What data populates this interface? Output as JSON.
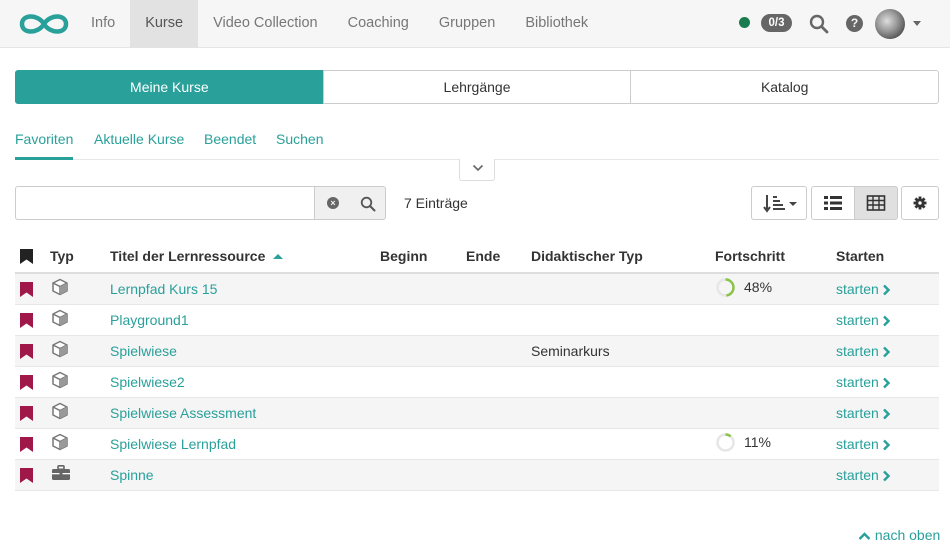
{
  "nav": {
    "items": [
      {
        "label": "Info",
        "active": false
      },
      {
        "label": "Kurse",
        "active": true
      },
      {
        "label": "Video Collection",
        "active": false
      },
      {
        "label": "Coaching",
        "active": false
      },
      {
        "label": "Gruppen",
        "active": false
      },
      {
        "label": "Bibliothek",
        "active": false
      }
    ],
    "badge": "0/3",
    "status_color": "#1a7c4e"
  },
  "segments": [
    {
      "label": "Meine Kurse",
      "active": true
    },
    {
      "label": "Lehrgänge",
      "active": false
    },
    {
      "label": "Katalog",
      "active": false
    }
  ],
  "subtabs": [
    {
      "label": "Favoriten",
      "active": true
    },
    {
      "label": "Aktuelle Kurse",
      "active": false
    },
    {
      "label": "Beendet",
      "active": false
    },
    {
      "label": "Suchen",
      "active": false
    }
  ],
  "search": {
    "value": "",
    "placeholder": ""
  },
  "entries_count": "7 Einträge",
  "table": {
    "headers": {
      "typ": "Typ",
      "title": "Titel der Lernressource",
      "begin": "Beginn",
      "end": "Ende",
      "didactic": "Didaktischer Typ",
      "progress": "Fortschritt",
      "start": "Starten"
    },
    "rows": [
      {
        "type_icon": "cube-icon",
        "title": "Lernpfad Kurs 15",
        "didactic": "",
        "progress": "48%",
        "progress_value": 0.48,
        "start": "starten"
      },
      {
        "type_icon": "cube-icon",
        "title": "Playground1",
        "didactic": "",
        "progress": "",
        "progress_value": null,
        "start": "starten"
      },
      {
        "type_icon": "cube-icon",
        "title": "Spielwiese",
        "didactic": "Seminarkurs",
        "progress": "",
        "progress_value": null,
        "start": "starten"
      },
      {
        "type_icon": "cube-icon",
        "title": "Spielwiese2",
        "didactic": "",
        "progress": "",
        "progress_value": null,
        "start": "starten"
      },
      {
        "type_icon": "cube-icon",
        "title": "Spielwiese Assessment",
        "didactic": "",
        "progress": "",
        "progress_value": null,
        "start": "starten"
      },
      {
        "type_icon": "cube-icon",
        "title": "Spielwiese Lernpfad",
        "didactic": "",
        "progress": "11%",
        "progress_value": 0.11,
        "start": "starten"
      },
      {
        "type_icon": "briefcase-icon",
        "title": "Spinne",
        "didactic": "",
        "progress": "",
        "progress_value": null,
        "start": "starten"
      }
    ]
  },
  "to_top": "nach oben",
  "colors": {
    "accent": "#29a09a",
    "bookmark": "#a0184a",
    "progress": "#8bc34a"
  }
}
